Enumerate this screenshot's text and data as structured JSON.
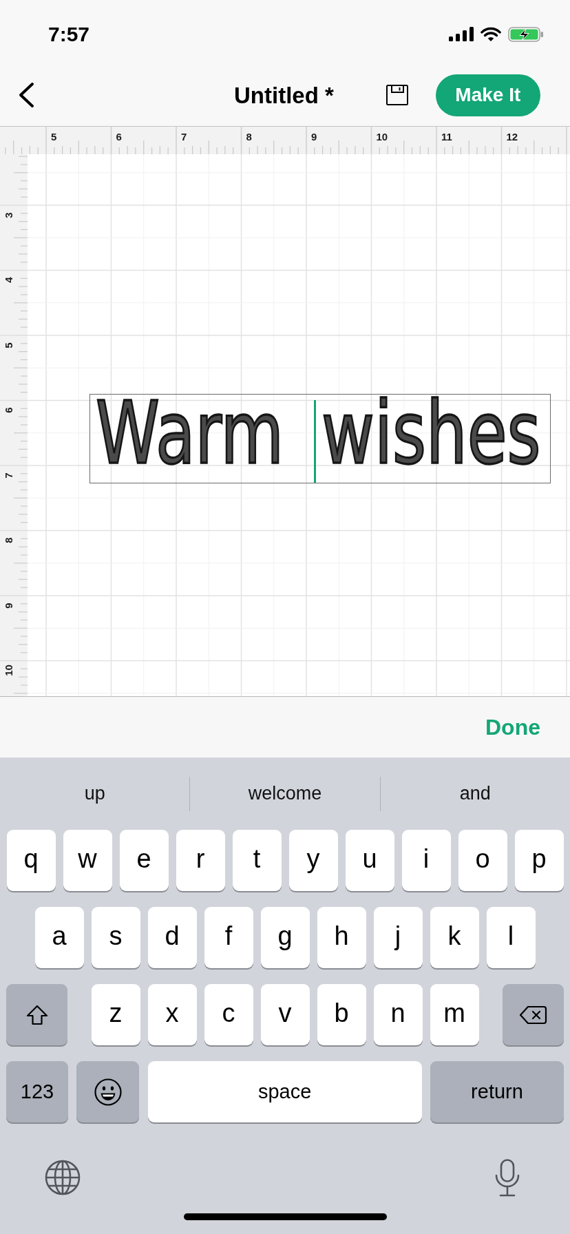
{
  "status_bar": {
    "time": "7:57"
  },
  "nav_bar": {
    "title": "Untitled *",
    "make_button": "Make It"
  },
  "canvas": {
    "horizontal_ruler": [
      "5",
      "6",
      "7",
      "8",
      "9",
      "10",
      "11",
      "12"
    ],
    "vertical_ruler": [
      "3",
      "4",
      "5",
      "6",
      "7",
      "8",
      "9",
      "10"
    ],
    "text_box": {
      "segments": [
        {
          "kind": "text",
          "text": "Warm"
        },
        {
          "kind": "cursor"
        },
        {
          "kind": "text",
          "text": "wishes"
        }
      ]
    }
  },
  "accessory_bar": {
    "done_button": "Done"
  },
  "keyboard": {
    "suggestions": [
      "up",
      "welcome",
      "and"
    ],
    "rows": [
      {
        "keys": [
          {
            "kind": "letter",
            "label": "q"
          },
          {
            "kind": "letter",
            "label": "w"
          },
          {
            "kind": "letter",
            "label": "e"
          },
          {
            "kind": "letter",
            "label": "r"
          },
          {
            "kind": "letter",
            "label": "t"
          },
          {
            "kind": "letter",
            "label": "y"
          },
          {
            "kind": "letter",
            "label": "u"
          },
          {
            "kind": "letter",
            "label": "i"
          },
          {
            "kind": "letter",
            "label": "o"
          },
          {
            "kind": "letter",
            "label": "p"
          }
        ]
      },
      {
        "keys": [
          {
            "kind": "letter",
            "label": "a"
          },
          {
            "kind": "letter",
            "label": "s"
          },
          {
            "kind": "letter",
            "label": "d"
          },
          {
            "kind": "letter",
            "label": "f"
          },
          {
            "kind": "letter",
            "label": "g"
          },
          {
            "kind": "letter",
            "label": "h"
          },
          {
            "kind": "letter",
            "label": "j"
          },
          {
            "kind": "letter",
            "label": "k"
          },
          {
            "kind": "letter",
            "label": "l"
          }
        ]
      },
      {
        "keys": [
          {
            "kind": "shift"
          },
          {
            "kind": "letter",
            "label": "z"
          },
          {
            "kind": "letter",
            "label": "x"
          },
          {
            "kind": "letter",
            "label": "c"
          },
          {
            "kind": "letter",
            "label": "v"
          },
          {
            "kind": "letter",
            "label": "b"
          },
          {
            "kind": "letter",
            "label": "n"
          },
          {
            "kind": "letter",
            "label": "m"
          },
          {
            "kind": "delete"
          }
        ]
      },
      {
        "keys": [
          {
            "kind": "numbers",
            "label": "123"
          },
          {
            "kind": "emoji"
          },
          {
            "kind": "space",
            "label": "space"
          },
          {
            "kind": "return",
            "label": "return"
          }
        ]
      }
    ]
  }
}
